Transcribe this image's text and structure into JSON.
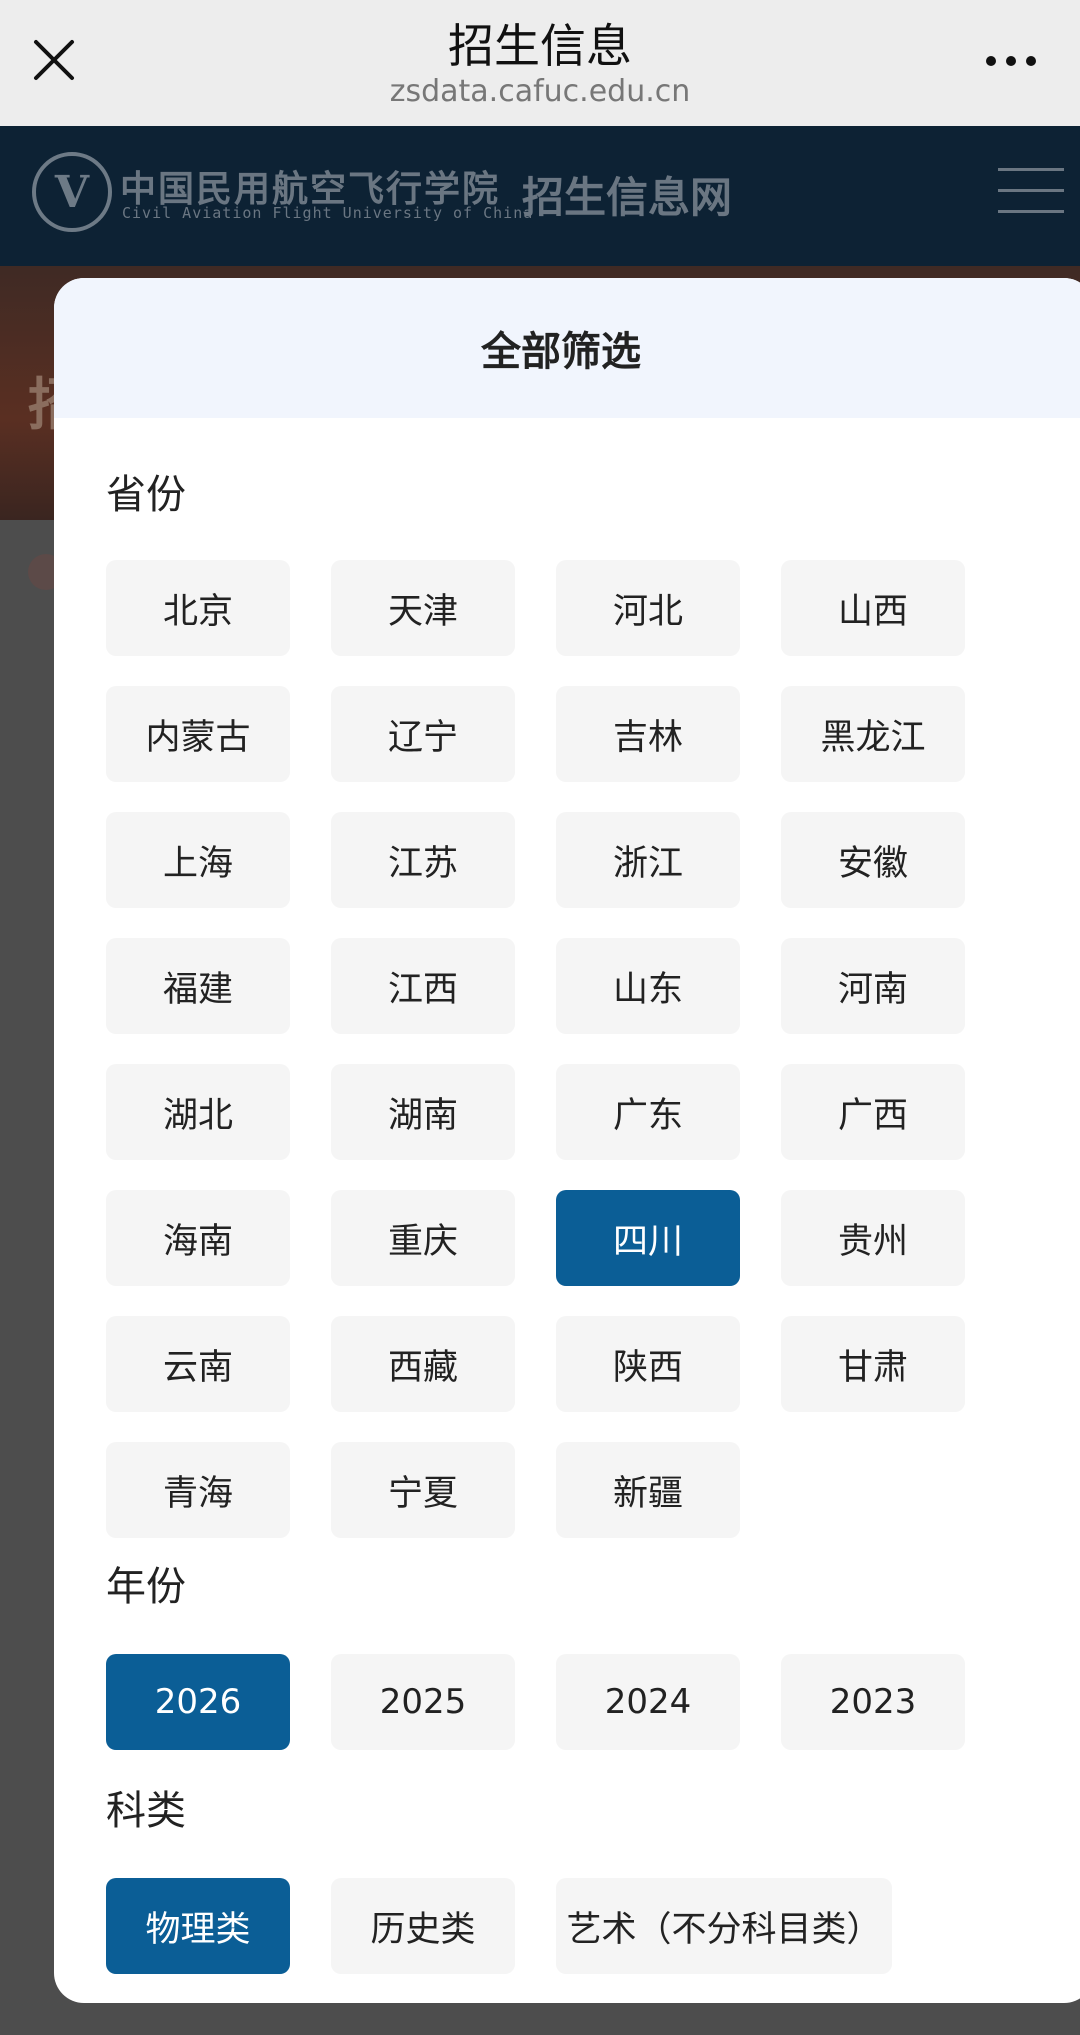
{
  "browser": {
    "title": "招生信息",
    "url": "zsdata.cafuc.edu.cn"
  },
  "site": {
    "logo_letter": "V",
    "name_cn": "中国民用航空飞行学院",
    "name_en": "Civil Aviation Flight University of China",
    "site_title": "招生信息网",
    "banner_ghost": "招"
  },
  "panel": {
    "title": "全部筛选",
    "province_label": "省份",
    "provinces": [
      "北京",
      "天津",
      "河北",
      "山西",
      "内蒙古",
      "辽宁",
      "吉林",
      "黑龙江",
      "上海",
      "江苏",
      "浙江",
      "安徽",
      "福建",
      "江西",
      "山东",
      "河南",
      "湖北",
      "湖南",
      "广东",
      "广西",
      "海南",
      "重庆",
      "四川",
      "贵州",
      "云南",
      "西藏",
      "陕西",
      "甘肃",
      "青海",
      "宁夏",
      "新疆"
    ],
    "selected_province": "四川",
    "year_label": "年份",
    "years": [
      "2026",
      "2025",
      "2024",
      "2023"
    ],
    "selected_year": "2026",
    "category_label": "科类",
    "categories": [
      "物理类",
      "历史类",
      "艺术（不分科目类）"
    ],
    "selected_category": "物理类"
  },
  "colors": {
    "accent": "#0b5e96",
    "chip_bg": "#f5f5f5",
    "panel_head_bg": "#f1f5fd"
  }
}
